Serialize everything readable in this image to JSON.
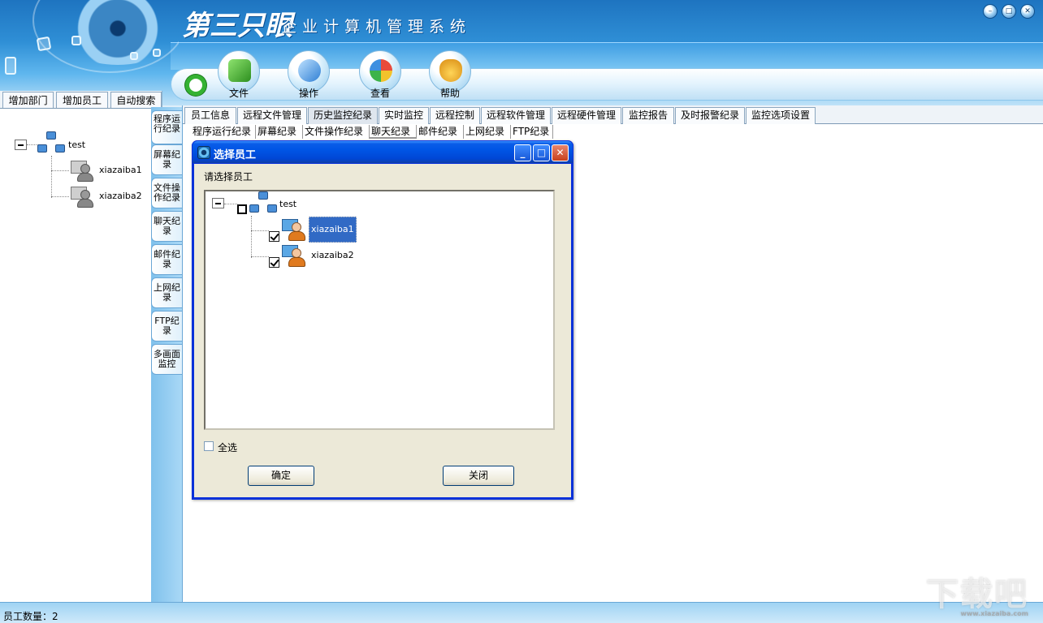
{
  "app": {
    "title_main": "第三只眼",
    "title_sub": "企业计算机管理系统"
  },
  "window_buttons": [
    "minimize",
    "restore",
    "close"
  ],
  "toolbar": [
    {
      "label": "文件",
      "icon": "file-icon",
      "color": "#4cae3a"
    },
    {
      "label": "操作",
      "icon": "operation-icon",
      "color": "#3b8ed8"
    },
    {
      "label": "查看",
      "icon": "view-icon",
      "color": "#e7a93a"
    },
    {
      "label": "帮助",
      "icon": "help-icon",
      "color": "#f0b934"
    }
  ],
  "left_tabs": [
    "增加部门",
    "增加员工",
    "自动搜索"
  ],
  "left_tree": {
    "root": "test",
    "children": [
      "xiazaiba1",
      "xiazaiba2"
    ]
  },
  "side_tabs": [
    "程序运行纪录",
    "屏幕纪录",
    "文件操作纪录",
    "聊天纪录",
    "邮件纪录",
    "上网纪录",
    "FTP纪录",
    "多画面监控"
  ],
  "main_tabs": [
    "员工信息",
    "远程文件管理",
    "历史监控纪录",
    "实时监控",
    "远程控制",
    "远程软件管理",
    "远程硬件管理",
    "监控报告",
    "及时报警纪录",
    "监控选项设置"
  ],
  "active_main_tab": "历史监控纪录",
  "sub_tabs": [
    "程序运行纪录",
    "屏幕纪录",
    "文件操作纪录",
    "聊天纪录",
    "邮件纪录",
    "上网纪录",
    "FTP纪录"
  ],
  "active_sub_tab": "聊天纪录",
  "dialog": {
    "title": "选择员工",
    "prompt": "请选择员工",
    "tree_root": "test",
    "tree_items": [
      {
        "name": "xiazaiba1",
        "checked": true,
        "selected": true
      },
      {
        "name": "xiazaiba2",
        "checked": true,
        "selected": false
      }
    ],
    "select_all_label": "全选",
    "select_all_checked": false,
    "ok_label": "确定",
    "close_label": "关闭"
  },
  "status": {
    "text": "员工数量：2"
  },
  "watermark": {
    "text": "下载吧",
    "url": "www.xiazaiba.com"
  }
}
